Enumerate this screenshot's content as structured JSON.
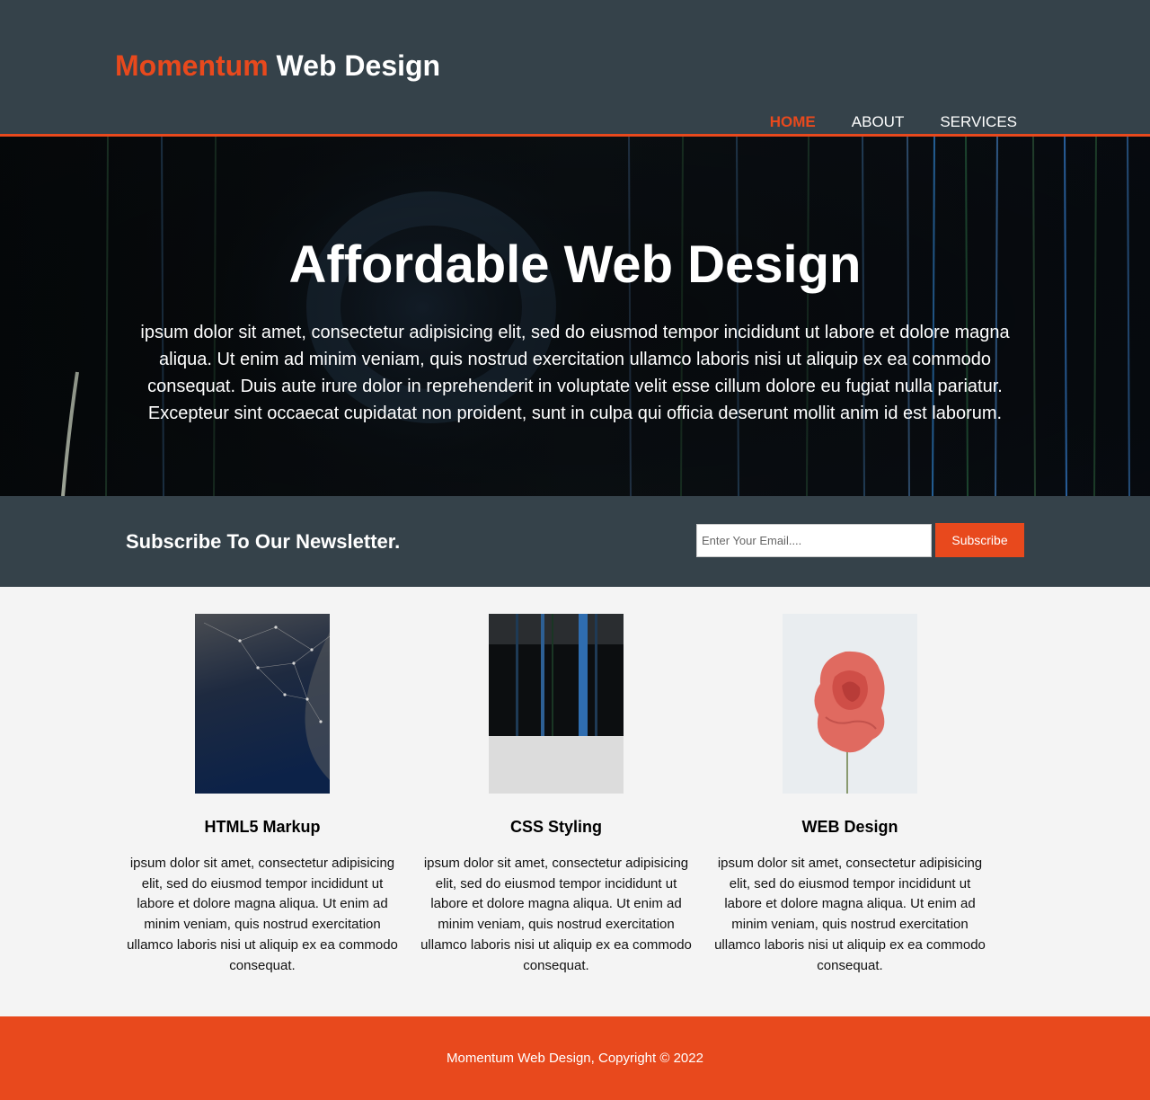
{
  "header": {
    "brand_accent": "Momentum",
    "brand_rest": "Web Design",
    "nav": [
      {
        "label": "HOME",
        "active": true
      },
      {
        "label": "ABOUT",
        "active": false
      },
      {
        "label": "SERVICES",
        "active": false
      }
    ]
  },
  "showcase": {
    "title": "Affordable Web Design",
    "text": "ipsum dolor sit amet, consectetur adipisicing elit, sed do eiusmod tempor incididunt ut labore et dolore magna aliqua. Ut enim ad minim veniam, quis nostrud exercitation ullamco laboris nisi ut aliquip ex ea commodo consequat. Duis aute irure dolor in reprehenderit in voluptate velit esse cillum dolore eu fugiat nulla pariatur. Excepteur sint occaecat cupidatat non proident, sunt in culpa qui officia deserunt mollit anim id est laborum."
  },
  "newsletter": {
    "heading": "Subscribe To Our Newsletter.",
    "email_placeholder": "Enter Your Email....",
    "email_value": "",
    "button_label": "Subscribe"
  },
  "boxes": [
    {
      "title": "HTML5 Markup",
      "text": "ipsum dolor sit amet, consectetur adipisicing elit, sed do eiusmod tempor incididunt ut labore et dolore magna aliqua. Ut enim ad minim veniam, quis nostrud exercitation ullamco laboris nisi ut aliquip ex ea commodo consequat."
    },
    {
      "title": "CSS Styling",
      "text": "ipsum dolor sit amet, consectetur adipisicing elit, sed do eiusmod tempor incididunt ut labore et dolore magna aliqua. Ut enim ad minim veniam, quis nostrud exercitation ullamco laboris nisi ut aliquip ex ea commodo consequat."
    },
    {
      "title": "WEB Design",
      "text": "ipsum dolor sit amet, consectetur adipisicing elit, sed do eiusmod tempor incididunt ut labore et dolore magna aliqua. Ut enim ad minim veniam, quis nostrud exercitation ullamco laboris nisi ut aliquip ex ea commodo consequat."
    }
  ],
  "footer": {
    "text": "Momentum Web Design, Copyright © 2022"
  },
  "colors": {
    "accent": "#e8491d",
    "dark": "#35424a",
    "light_bg": "#f4f4f4"
  }
}
